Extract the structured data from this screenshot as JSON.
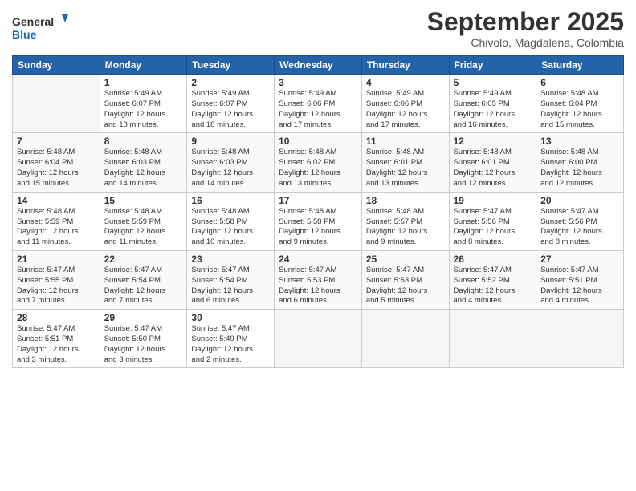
{
  "header": {
    "logo_line1": "General",
    "logo_line2": "Blue",
    "month": "September 2025",
    "location": "Chivolo, Magdalena, Colombia"
  },
  "weekdays": [
    "Sunday",
    "Monday",
    "Tuesday",
    "Wednesday",
    "Thursday",
    "Friday",
    "Saturday"
  ],
  "weeks": [
    [
      {
        "day": "",
        "info": ""
      },
      {
        "day": "1",
        "info": "Sunrise: 5:49 AM\nSunset: 6:07 PM\nDaylight: 12 hours\nand 18 minutes."
      },
      {
        "day": "2",
        "info": "Sunrise: 5:49 AM\nSunset: 6:07 PM\nDaylight: 12 hours\nand 18 minutes."
      },
      {
        "day": "3",
        "info": "Sunrise: 5:49 AM\nSunset: 6:06 PM\nDaylight: 12 hours\nand 17 minutes."
      },
      {
        "day": "4",
        "info": "Sunrise: 5:49 AM\nSunset: 6:06 PM\nDaylight: 12 hours\nand 17 minutes."
      },
      {
        "day": "5",
        "info": "Sunrise: 5:49 AM\nSunset: 6:05 PM\nDaylight: 12 hours\nand 16 minutes."
      },
      {
        "day": "6",
        "info": "Sunrise: 5:48 AM\nSunset: 6:04 PM\nDaylight: 12 hours\nand 15 minutes."
      }
    ],
    [
      {
        "day": "7",
        "info": "Sunrise: 5:48 AM\nSunset: 6:04 PM\nDaylight: 12 hours\nand 15 minutes."
      },
      {
        "day": "8",
        "info": "Sunrise: 5:48 AM\nSunset: 6:03 PM\nDaylight: 12 hours\nand 14 minutes."
      },
      {
        "day": "9",
        "info": "Sunrise: 5:48 AM\nSunset: 6:03 PM\nDaylight: 12 hours\nand 14 minutes."
      },
      {
        "day": "10",
        "info": "Sunrise: 5:48 AM\nSunset: 6:02 PM\nDaylight: 12 hours\nand 13 minutes."
      },
      {
        "day": "11",
        "info": "Sunrise: 5:48 AM\nSunset: 6:01 PM\nDaylight: 12 hours\nand 13 minutes."
      },
      {
        "day": "12",
        "info": "Sunrise: 5:48 AM\nSunset: 6:01 PM\nDaylight: 12 hours\nand 12 minutes."
      },
      {
        "day": "13",
        "info": "Sunrise: 5:48 AM\nSunset: 6:00 PM\nDaylight: 12 hours\nand 12 minutes."
      }
    ],
    [
      {
        "day": "14",
        "info": "Sunrise: 5:48 AM\nSunset: 5:59 PM\nDaylight: 12 hours\nand 11 minutes."
      },
      {
        "day": "15",
        "info": "Sunrise: 5:48 AM\nSunset: 5:59 PM\nDaylight: 12 hours\nand 11 minutes."
      },
      {
        "day": "16",
        "info": "Sunrise: 5:48 AM\nSunset: 5:58 PM\nDaylight: 12 hours\nand 10 minutes."
      },
      {
        "day": "17",
        "info": "Sunrise: 5:48 AM\nSunset: 5:58 PM\nDaylight: 12 hours\nand 9 minutes."
      },
      {
        "day": "18",
        "info": "Sunrise: 5:48 AM\nSunset: 5:57 PM\nDaylight: 12 hours\nand 9 minutes."
      },
      {
        "day": "19",
        "info": "Sunrise: 5:47 AM\nSunset: 5:56 PM\nDaylight: 12 hours\nand 8 minutes."
      },
      {
        "day": "20",
        "info": "Sunrise: 5:47 AM\nSunset: 5:56 PM\nDaylight: 12 hours\nand 8 minutes."
      }
    ],
    [
      {
        "day": "21",
        "info": "Sunrise: 5:47 AM\nSunset: 5:55 PM\nDaylight: 12 hours\nand 7 minutes."
      },
      {
        "day": "22",
        "info": "Sunrise: 5:47 AM\nSunset: 5:54 PM\nDaylight: 12 hours\nand 7 minutes."
      },
      {
        "day": "23",
        "info": "Sunrise: 5:47 AM\nSunset: 5:54 PM\nDaylight: 12 hours\nand 6 minutes."
      },
      {
        "day": "24",
        "info": "Sunrise: 5:47 AM\nSunset: 5:53 PM\nDaylight: 12 hours\nand 6 minutes."
      },
      {
        "day": "25",
        "info": "Sunrise: 5:47 AM\nSunset: 5:53 PM\nDaylight: 12 hours\nand 5 minutes."
      },
      {
        "day": "26",
        "info": "Sunrise: 5:47 AM\nSunset: 5:52 PM\nDaylight: 12 hours\nand 4 minutes."
      },
      {
        "day": "27",
        "info": "Sunrise: 5:47 AM\nSunset: 5:51 PM\nDaylight: 12 hours\nand 4 minutes."
      }
    ],
    [
      {
        "day": "28",
        "info": "Sunrise: 5:47 AM\nSunset: 5:51 PM\nDaylight: 12 hours\nand 3 minutes."
      },
      {
        "day": "29",
        "info": "Sunrise: 5:47 AM\nSunset: 5:50 PM\nDaylight: 12 hours\nand 3 minutes."
      },
      {
        "day": "30",
        "info": "Sunrise: 5:47 AM\nSunset: 5:49 PM\nDaylight: 12 hours\nand 2 minutes."
      },
      {
        "day": "",
        "info": ""
      },
      {
        "day": "",
        "info": ""
      },
      {
        "day": "",
        "info": ""
      },
      {
        "day": "",
        "info": ""
      }
    ]
  ]
}
